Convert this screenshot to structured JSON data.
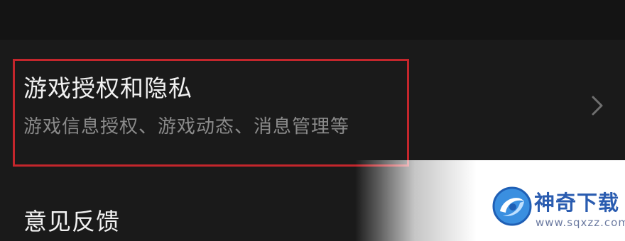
{
  "settings": {
    "privacy_item": {
      "title": "游戏授权和隐私",
      "subtitle": "游戏信息授权、游戏动态、消息管理等",
      "chevron_icon": "chevron-right-icon"
    },
    "feedback_item": {
      "title": "意见反馈"
    },
    "highlight_color": "#c4262c"
  },
  "watermark": {
    "brand": "神奇下载",
    "url": "www.sqxzz.com",
    "logo_icon": "swirl-logo-icon",
    "brand_color": "#2a5cb0"
  }
}
